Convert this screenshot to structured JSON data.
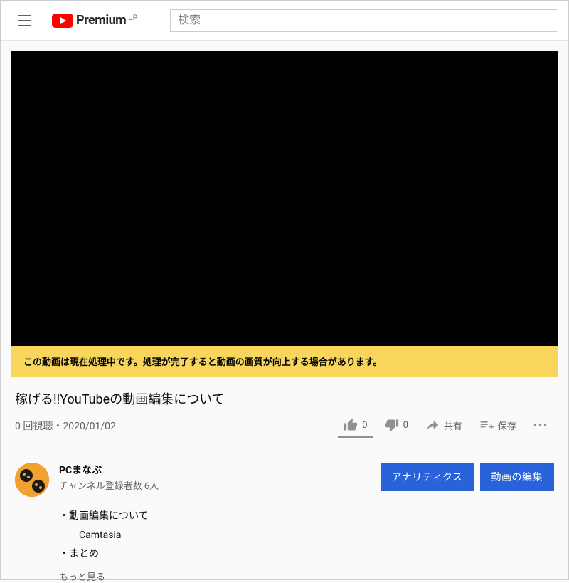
{
  "header": {
    "logo_text": "Premium",
    "country": "JP",
    "search_placeholder": "検索"
  },
  "banner": {
    "message": "この動画は現在処理中です。処理が完了すると動画の画質が向上する場合があります。"
  },
  "video": {
    "title": "稼げる!!YouTubeの動画編集について",
    "views_date": "0 回視聴・2020/01/02"
  },
  "actions": {
    "like_count": "0",
    "dislike_count": "0",
    "share_label": "共有",
    "save_label": "保存"
  },
  "channel": {
    "name": "PCまなぶ",
    "subscribers": "チャンネル登録者数 6人"
  },
  "buttons": {
    "analytics": "アナリティクス",
    "edit": "動画の編集"
  },
  "description": {
    "line1": "・動画編集について",
    "line2": "Camtasia",
    "line3": "・まとめ",
    "show_more": "もっと見る"
  }
}
